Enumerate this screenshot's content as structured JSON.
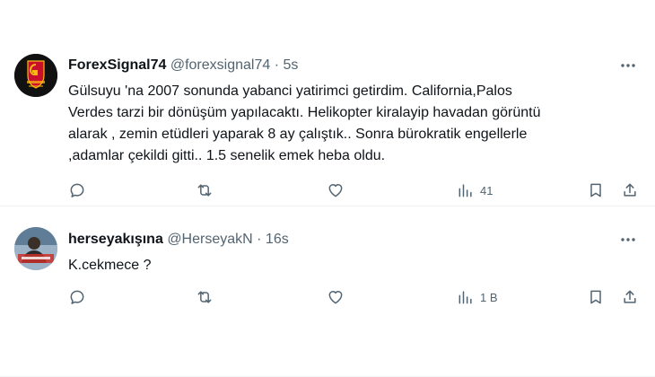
{
  "tweets": [
    {
      "display_name": "ForexSignal74",
      "handle": "@forexsignal74",
      "separator": "·",
      "time": "5s",
      "text": "Gülsuyu 'na 2007 sonunda yabanci yatirimci getirdim. California,Palos\nVerdes tarzi bir dönüşüm yapılacaktı. Helikopter kiralayip havadan görüntü\nalarak , zemin etüdleri yaparak 8 ay çalıştık.. Sonra bürokratik engellerle\n,adamlar çekildi gitti.. 1.5 senelik emek heba oldu.",
      "views": "41",
      "avatar_icon": "galatasaray-crest-icon"
    },
    {
      "display_name": "herseyakışına",
      "handle": "@HerseyakN",
      "separator": "·",
      "time": "16s",
      "text": "K.cekmece ?",
      "views": "1 B",
      "avatar_icon": "person-photo-icon"
    }
  ],
  "colors": {
    "text": "#0f1419",
    "secondary": "#536471",
    "divider": "#eff3f4",
    "crest_red": "#c8102e",
    "crest_yellow": "#fdb912"
  }
}
